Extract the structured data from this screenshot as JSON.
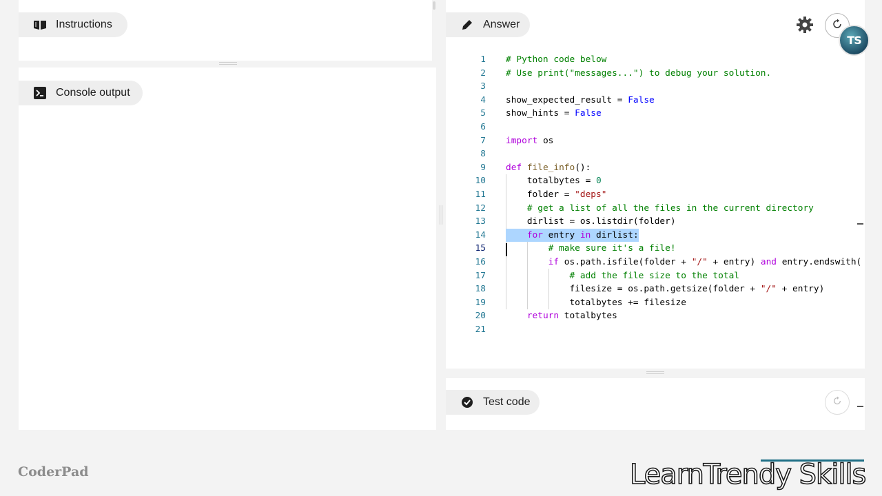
{
  "instructions_tab": {
    "label": "Instructions",
    "icon": "book-icon"
  },
  "console_tab": {
    "label": "Console output",
    "icon": "terminal-icon"
  },
  "answer_tab": {
    "label": "Answer",
    "icon": "pencil-icon"
  },
  "test_tab": {
    "label": "Test code",
    "icon": "check-circle-icon"
  },
  "toolbar": {
    "settings_icon": "gear-icon",
    "reset_icon": "refresh-icon",
    "avatar_initials": "TS"
  },
  "editor": {
    "active_line": 15,
    "selected_line": 14,
    "lines": [
      {
        "n": "1",
        "text": "# Python code below"
      },
      {
        "n": "2",
        "text": "# Use print(\"messages...\") to debug your solution."
      },
      {
        "n": "3",
        "text": ""
      },
      {
        "n": "4",
        "text": "show_expected_result = False"
      },
      {
        "n": "5",
        "text": "show_hints = False"
      },
      {
        "n": "6",
        "text": ""
      },
      {
        "n": "7",
        "text": "import os"
      },
      {
        "n": "8",
        "text": ""
      },
      {
        "n": "9",
        "text": "def file_info():"
      },
      {
        "n": "10",
        "text": "    totalbytes = 0"
      },
      {
        "n": "11",
        "text": "    folder = \"deps\""
      },
      {
        "n": "12",
        "text": "    # get a list of all the files in the current directory"
      },
      {
        "n": "13",
        "text": "    dirlist = os.listdir(folder)"
      },
      {
        "n": "14",
        "text": "    for entry in dirlist:"
      },
      {
        "n": "15",
        "text": "        # make sure it's a file!"
      },
      {
        "n": "16",
        "text": "        if os.path.isfile(folder + \"/\" + entry) and entry.endswith("
      },
      {
        "n": "17",
        "text": "            # add the file size to the total"
      },
      {
        "n": "18",
        "text": "            filesize = os.path.getsize(folder + \"/\" + entry)"
      },
      {
        "n": "19",
        "text": "            totalbytes += filesize"
      },
      {
        "n": "20",
        "text": "    return totalbytes"
      },
      {
        "n": "21",
        "text": ""
      }
    ]
  },
  "footer": {
    "brand": "CoderPad",
    "watermark": "LearnTrendy Skills"
  },
  "colors": {
    "selection": "#add6ff",
    "line_number": "#237893",
    "comment": "#008000",
    "keyword": "#af00db",
    "string": "#a31515",
    "number": "#098658"
  }
}
